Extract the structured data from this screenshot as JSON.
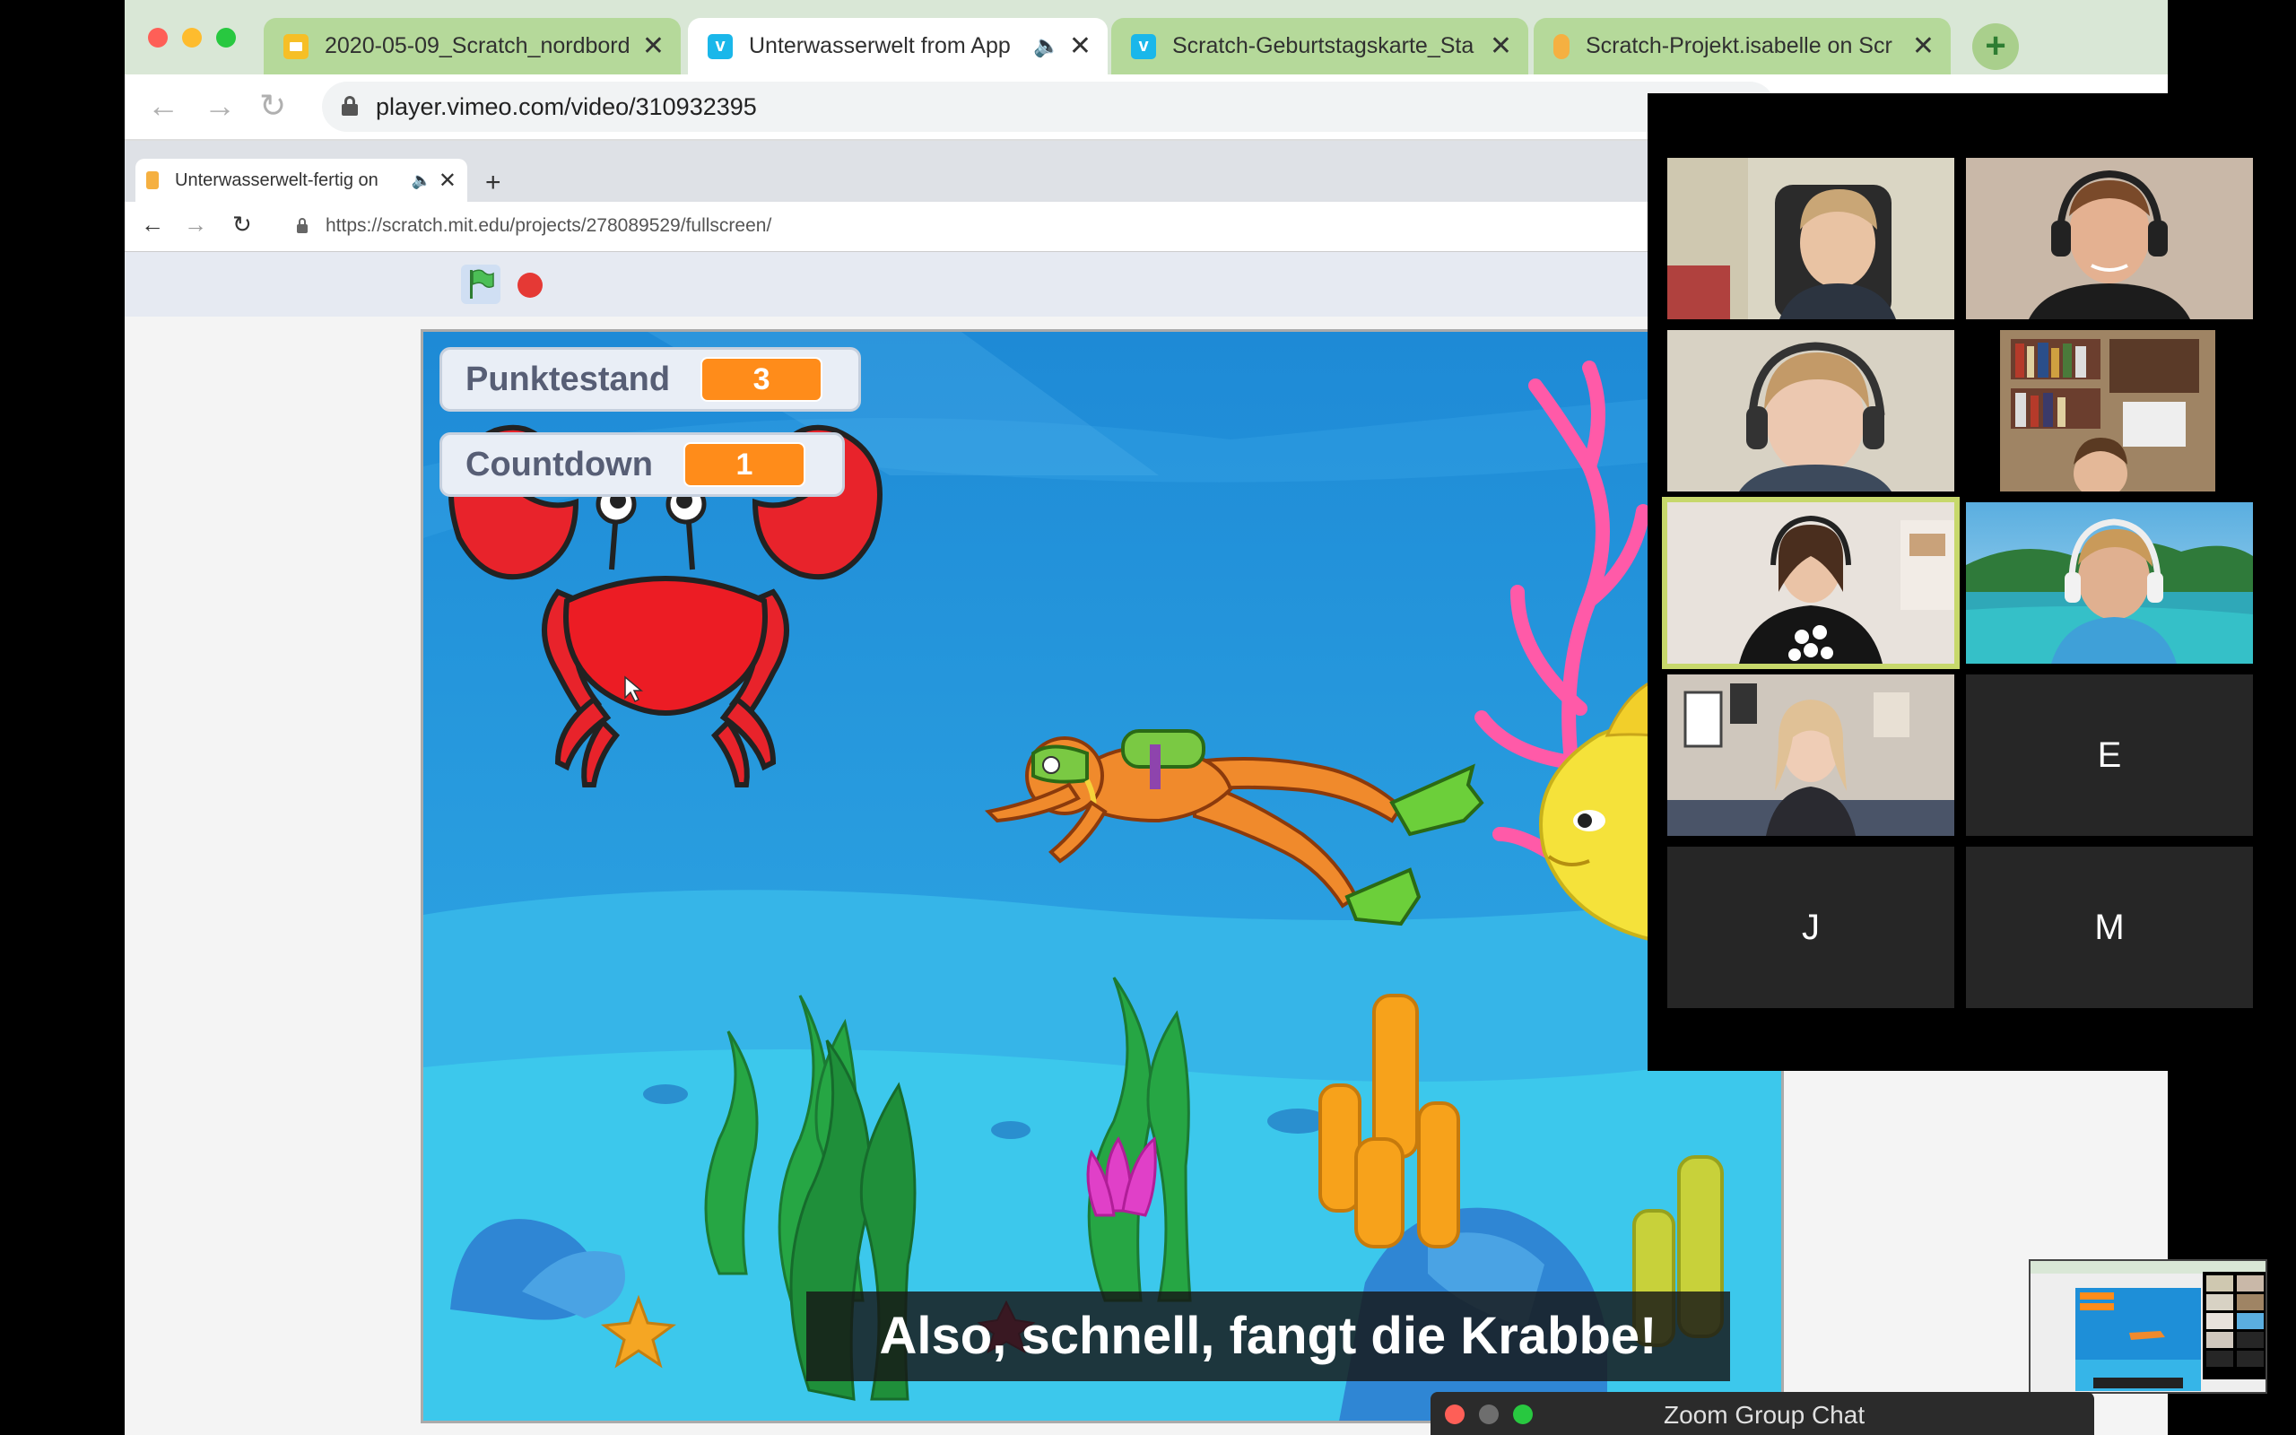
{
  "browser": {
    "tabs": [
      {
        "title": "2020-05-09_Scratch_nordbord",
        "favicon": "slides-icon",
        "color": "#f6bf26"
      },
      {
        "title": "Unterwasserwelt from App",
        "favicon": "vimeo-icon",
        "color": "#1ab7ea",
        "active": true
      },
      {
        "title": "Scratch-Geburtstagskarte_Sta",
        "favicon": "vimeo-icon",
        "color": "#1ab7ea"
      },
      {
        "title": "Scratch-Projekt.isabelle on Scr",
        "favicon": "scratch-icon",
        "color": "#f5b041"
      }
    ],
    "url": "player.vimeo.com/video/310932395"
  },
  "inner_browser": {
    "tab_title": "Unterwasserwelt-fertig on",
    "url": "https://scratch.mit.edu/projects/278089529/fullscreen/"
  },
  "stage": {
    "monitors": [
      {
        "label": "Punktestand",
        "value": "3"
      },
      {
        "label": "Countdown",
        "value": "1"
      }
    ]
  },
  "video": {
    "subtitle": "Also, schnell, fangt die Krabbe!"
  },
  "zoom": {
    "participants": [
      {
        "type": "video"
      },
      {
        "type": "video"
      },
      {
        "type": "video"
      },
      {
        "type": "video"
      },
      {
        "type": "video",
        "speaking": true
      },
      {
        "type": "video"
      },
      {
        "type": "video"
      },
      {
        "type": "name",
        "initial": "E"
      },
      {
        "type": "name",
        "initial": "J"
      },
      {
        "type": "name",
        "initial": "M"
      }
    ],
    "chat_title": "Zoom Group Chat"
  },
  "colors": {
    "tab_strip": "#d9e7d6",
    "inactive_tab": "#b5d99a",
    "stage_water": "#1e8fd8",
    "monitor_value": "#ff8c1a",
    "speaker_highlight": "#c7d86b"
  }
}
